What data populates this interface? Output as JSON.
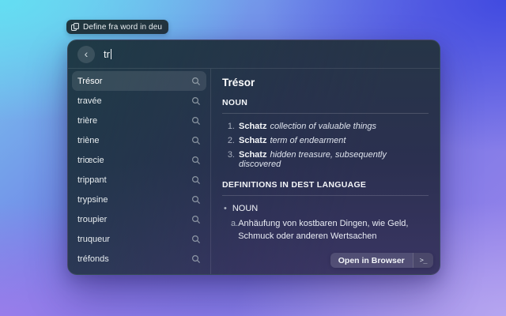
{
  "command_tag": {
    "label": "Define fra word in deu"
  },
  "search": {
    "query": "tr"
  },
  "list": {
    "items": [
      {
        "label": "Trésor",
        "selected": true
      },
      {
        "label": "travée"
      },
      {
        "label": "trière"
      },
      {
        "label": "triène"
      },
      {
        "label": "triœcie"
      },
      {
        "label": "trippant"
      },
      {
        "label": "trypsine"
      },
      {
        "label": "troupier"
      },
      {
        "label": "truqueur"
      },
      {
        "label": "tréfonds"
      }
    ]
  },
  "detail": {
    "title": "Trésor",
    "pos_header": "NOUN",
    "definitions": [
      {
        "num": "1.",
        "term": "Schatz",
        "gloss": "collection of valuable things"
      },
      {
        "num": "2.",
        "term": "Schatz",
        "gloss": "term of endearment"
      },
      {
        "num": "3.",
        "term": "Schatz",
        "gloss": "hidden treasure, subsequently discovered"
      }
    ],
    "dest_header": "DEFINITIONS IN DEST LANGUAGE",
    "dest_bullet": "•",
    "dest_pos": "NOUN",
    "dest_items": [
      {
        "letter": "a.",
        "text": "Anhäufung von kostbaren Dingen, wie Geld, Schmuck oder anderen Wertsachen"
      }
    ]
  },
  "actions": {
    "open_in_browser_label": "Open in Browser",
    "shortcut_glyph": ">_"
  },
  "colors": {
    "bg_top_left": "#62dff2",
    "bg_top_right": "#3e48e0",
    "bg_bottom_left": "#9b7dea",
    "bg_bottom_right": "#b7a7f0",
    "panel_top": "#263547",
    "panel_bottom": "#3a3563",
    "selection": "rgba(255,255,255,0.10)"
  }
}
